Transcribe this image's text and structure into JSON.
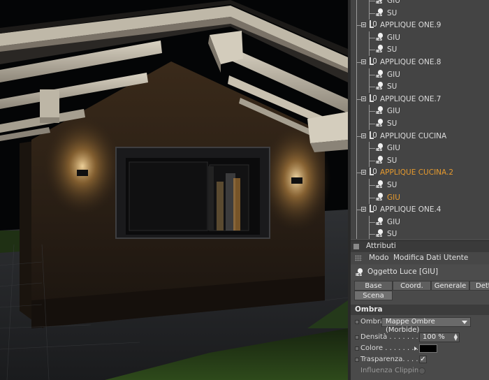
{
  "tree": {
    "items": [
      {
        "label": "GIU",
        "kind": "light"
      },
      {
        "label": "SU",
        "kind": "light"
      },
      {
        "label": "APPLIQUE ONE.9",
        "kind": "group"
      },
      {
        "label": "GIU",
        "kind": "light"
      },
      {
        "label": "SU",
        "kind": "light"
      },
      {
        "label": "APPLIQUE ONE.8",
        "kind": "group"
      },
      {
        "label": "GIU",
        "kind": "light"
      },
      {
        "label": "SU",
        "kind": "light"
      },
      {
        "label": "APPLIQUE ONE.7",
        "kind": "group"
      },
      {
        "label": "GIU",
        "kind": "light"
      },
      {
        "label": "SU",
        "kind": "light"
      },
      {
        "label": "APPLIQUE CUCINA",
        "kind": "group"
      },
      {
        "label": "GIU",
        "kind": "light"
      },
      {
        "label": "SU",
        "kind": "light"
      },
      {
        "label": "APPLIQUE CUCINA.2",
        "kind": "group",
        "active": true
      },
      {
        "label": "SU",
        "kind": "light"
      },
      {
        "label": "GIU",
        "kind": "light",
        "active": true
      },
      {
        "label": "APPLIQUE ONE.4",
        "kind": "group"
      },
      {
        "label": "GIU",
        "kind": "light"
      },
      {
        "label": "SU",
        "kind": "light"
      }
    ]
  },
  "attributes": {
    "title": "Attributi",
    "menu": [
      "Modo",
      "Modifica",
      "Dati Utente"
    ],
    "object_title": "Oggetto Luce [GIU]",
    "tabs": [
      "Base",
      "Coord.",
      "Generale",
      "Dett",
      "Scena"
    ],
    "active_tab": "Scena",
    "section": "Ombra",
    "shadow_label": "Ombra",
    "shadow_value": "Mappe Ombre (Morbide)",
    "density_label": "Densità . . . . . . . . . .",
    "density_value": "100 %",
    "color_label": "Colore . . . . . . . .",
    "color_value": "#000000",
    "transparency_label": "Trasparenza. . . . . .",
    "transparency_check": "✓",
    "clipping_label": "Influenza Clipping"
  },
  "colors": {
    "active_item": "#e69a2e",
    "panel_bg": "#4a4a4a"
  }
}
